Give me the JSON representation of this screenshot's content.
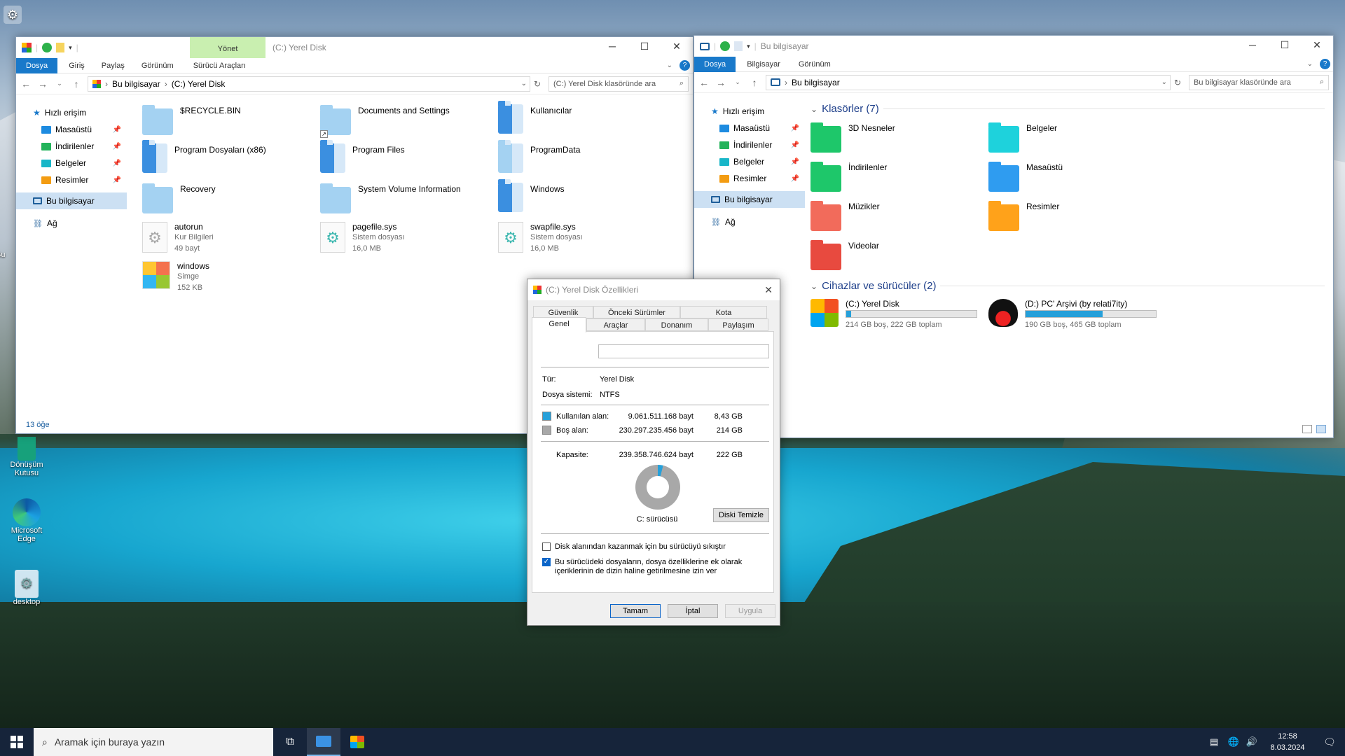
{
  "left_window": {
    "title": "(C:) Yerel Disk",
    "context_tab": "Yönet",
    "ribbon_tabs": [
      "Dosya",
      "Giriş",
      "Paylaş",
      "Görünüm",
      "Sürücü Araçları"
    ],
    "breadcrumb": [
      "Bu bilgisayar",
      "(C:) Yerel Disk"
    ],
    "search_placeholder": "(C:) Yerel Disk klasöründe ara",
    "sidebar": [
      {
        "label": "Hızlı erişim",
        "icon": "star-icon",
        "color": "#1979ca"
      },
      {
        "label": "Masaüstü",
        "icon": "folder-icon",
        "color": "#1d8be0",
        "pinned": true
      },
      {
        "label": "İndirilenler",
        "icon": "folder-icon",
        "color": "#22b35a",
        "pinned": true
      },
      {
        "label": "Belgeler",
        "icon": "folder-icon",
        "color": "#18b6c8",
        "pinned": true
      },
      {
        "label": "Resimler",
        "icon": "folder-icon",
        "color": "#f39c12",
        "pinned": true
      },
      {
        "label": "Bu bilgisayar",
        "icon": "computer-icon",
        "selected": true
      },
      {
        "label": "Ağ",
        "icon": "network-icon"
      }
    ],
    "items": [
      {
        "name": "$RECYCLE.BIN",
        "type": "folder",
        "color": "#a4d2f2"
      },
      {
        "name": "Documents and Settings",
        "type": "folder-shortcut",
        "color": "#a4d2f2"
      },
      {
        "name": "Kullanıcılar",
        "type": "folder-special",
        "color": "#3b8fe0"
      },
      {
        "name": "Program Dosyaları (x86)",
        "type": "folder-special",
        "color": "#3b8fe0"
      },
      {
        "name": "Program Files",
        "type": "folder-special",
        "color": "#3b8fe0"
      },
      {
        "name": "ProgramData",
        "type": "folder-special",
        "color": "#a4d2f2"
      },
      {
        "name": "Recovery",
        "type": "folder",
        "color": "#a4d2f2"
      },
      {
        "name": "System Volume Information",
        "type": "folder",
        "color": "#a4d2f2"
      },
      {
        "name": "Windows",
        "type": "folder-special",
        "color": "#3b8fe0"
      },
      {
        "name": "autorun",
        "type": "file-gear",
        "line2": "Kur Bilgileri",
        "line3": "49 bayt"
      },
      {
        "name": "pagefile.sys",
        "type": "file-sys",
        "line2": "Sistem dosyası",
        "line3": "16,0 MB"
      },
      {
        "name": "swapfile.sys",
        "type": "file-sys",
        "line2": "Sistem dosyası",
        "line3": "16,0 MB"
      },
      {
        "name": "windows",
        "type": "file-icon",
        "line2": "Simge",
        "line3": "152 KB"
      }
    ],
    "status": "13 öğe"
  },
  "right_window": {
    "title": "Bu bilgisayar",
    "ribbon_tabs": [
      "Dosya",
      "Bilgisayar",
      "Görünüm"
    ],
    "breadcrumb": [
      "Bu bilgisayar"
    ],
    "search_placeholder": "Bu bilgisayar klasöründe ara",
    "sidebar": [
      {
        "label": "Hızlı erişim",
        "icon": "star-icon",
        "color": "#1979ca"
      },
      {
        "label": "Masaüstü",
        "icon": "folder-icon",
        "color": "#1d8be0",
        "pinned": true
      },
      {
        "label": "İndirilenler",
        "icon": "folder-icon",
        "color": "#22b35a",
        "pinned": true
      },
      {
        "label": "Belgeler",
        "icon": "folder-icon",
        "color": "#18b6c8",
        "pinned": true
      },
      {
        "label": "Resimler",
        "icon": "folder-icon",
        "color": "#f39c12",
        "pinned": true
      },
      {
        "label": "Bu bilgisayar",
        "icon": "computer-icon",
        "selected": true
      },
      {
        "label": "Ağ",
        "icon": "network-icon"
      }
    ],
    "folders_header": "Klasörler (7)",
    "folders": [
      {
        "name": "3D Nesneler",
        "color": "#1ec76a"
      },
      {
        "name": "Belgeler",
        "color": "#1ed2dc"
      },
      {
        "name": "İndirilenler",
        "color": "#1ec76a"
      },
      {
        "name": "Masaüstü",
        "color": "#2f9cf0"
      },
      {
        "name": "Müzikler",
        "color": "#f26b5b"
      },
      {
        "name": "Resimler",
        "color": "#ffa21a"
      },
      {
        "name": "Videolar",
        "color": "#e84a3f"
      }
    ],
    "drives_header": "Cihazlar ve sürücüler (2)",
    "drives": [
      {
        "name": "(C:) Yerel Disk",
        "info": "214 GB boş, 222 GB toplam",
        "used_fraction": 0.04,
        "icon": "windows-drive-icon"
      },
      {
        "name": "(D:) PC' Arşivi (by relati7ity)",
        "info": "190 GB boş, 465 GB toplam",
        "used_fraction": 0.59,
        "icon": "hat-drive-icon"
      }
    ]
  },
  "dialog": {
    "title": "(C:) Yerel Disk Özellikleri",
    "tabs_top": [
      "Güvenlik",
      "Önceki Sürümler",
      "Kota"
    ],
    "tabs_bottom": [
      "Genel",
      "Araçlar",
      "Donanım",
      "Paylaşım"
    ],
    "type_label": "Tür:",
    "type_value": "Yerel Disk",
    "fs_label": "Dosya sistemi:",
    "fs_value": "NTFS",
    "used_label": "Kullanılan alan:",
    "used_bytes": "9.061.511.168 bayt",
    "used_gb": "8,43 GB",
    "free_label": "Boş alan:",
    "free_bytes": "230.297.235.456 bayt",
    "free_gb": "214 GB",
    "cap_label": "Kapasite:",
    "cap_bytes": "239.358.746.624 bayt",
    "cap_gb": "222 GB",
    "used_fraction": 0.038,
    "drive_label": "C: sürücüsü",
    "cleanup": "Diski Temizle",
    "compress": "Disk alanından kazanmak için bu sürücüyü sıkıştır",
    "index_line1": "Bu sürücüdeki dosyaların, dosya özelliklerine ek olarak",
    "index_line2": "içeriklerinin de dizin haline getirilmesine izin ver",
    "ok": "Tamam",
    "cancel": "İptal",
    "apply": "Uygula",
    "used_color": "#26a0da",
    "free_color": "#a8a8a8"
  },
  "desktop": [
    {
      "label1": "Dönüşüm",
      "label2": "Kutusu",
      "icon": "recycle-bin-icon"
    },
    {
      "label1": "Microsoft",
      "label2": "Edge",
      "icon": "edge-icon"
    },
    {
      "label1": "desktop",
      "label2": "",
      "icon": "gear-file-icon"
    }
  ],
  "desktop_fragments": [
    "Bu"
  ],
  "taskbar": {
    "search_placeholder": "Aramak için buraya yazın",
    "time": "12:58",
    "date": "8.03.2024"
  }
}
